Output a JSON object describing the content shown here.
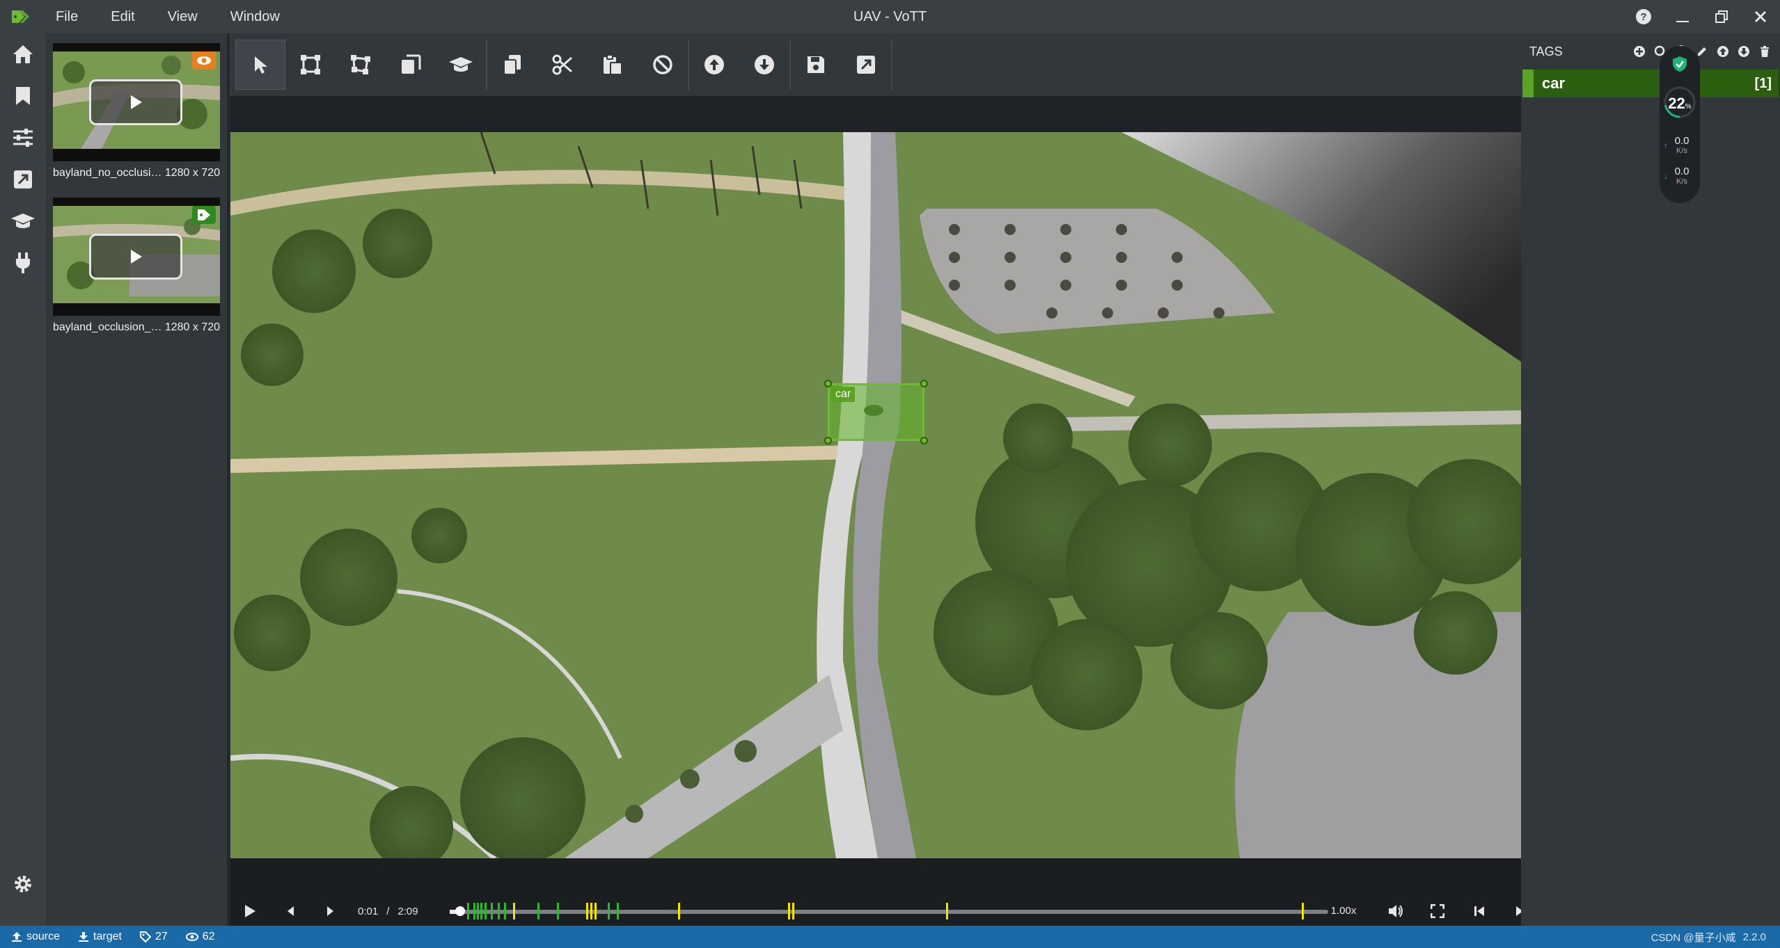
{
  "window": {
    "title": "UAV - VoTT"
  },
  "menu": [
    "File",
    "Edit",
    "View",
    "Window"
  ],
  "assets": [
    {
      "name": "bayland_no_occlusio...",
      "size": "1280 x 720",
      "badge": "eye-icon",
      "badge_color": "#e87f1c"
    },
    {
      "name": "bayland_occlusion_pl...",
      "size": "1280 x 720",
      "badge": "tag-icon",
      "badge_color": "#2d8a1e"
    }
  ],
  "toolbar": {
    "tools": [
      "select-icon",
      "rectangle-icon",
      "polygon-icon",
      "copy-rectangle-icon",
      "active-learning-icon",
      "copy-regions-icon",
      "cut-regions-icon",
      "paste-regions-icon",
      "remove-all-regions-icon",
      "previous-asset-icon",
      "next-asset-icon",
      "save-project-icon",
      "export-project-icon"
    ]
  },
  "region": {
    "tag": "car",
    "color": "#6cbd2c"
  },
  "video": {
    "current_time": "0:01",
    "duration": "2:09",
    "speed": "1.00x",
    "progress": 0.008,
    "marker_colors": [
      "#2db82d",
      "#f2e600"
    ]
  },
  "tags": {
    "header": "TAGS",
    "items": [
      {
        "name": "car",
        "hotkey": "[1]",
        "color": "#5ba323"
      }
    ]
  },
  "network_widget": {
    "cpu_percent": "22",
    "percent_sign": "%",
    "upload": "0.0",
    "download": "0.0",
    "unit": "K/s"
  },
  "status": {
    "source": "source",
    "target": "target",
    "tag_count": "27",
    "visited_count": "62",
    "watermark": "CSDN @量子小咸",
    "version": "2.2.0"
  }
}
